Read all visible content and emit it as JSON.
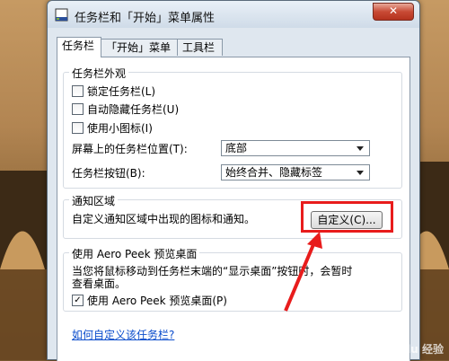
{
  "window": {
    "title": "任务栏和「开始」菜单属性",
    "close_symbol": "✕"
  },
  "tabs": [
    {
      "label": "任务栏",
      "selected": true
    },
    {
      "label": "「开始」菜单",
      "selected": false
    },
    {
      "label": "工具栏",
      "selected": false
    }
  ],
  "appearance": {
    "group_label": "任务栏外观",
    "lock_taskbar": {
      "label": "锁定任务栏(L)",
      "checked": false
    },
    "auto_hide": {
      "label": "自动隐藏任务栏(U)",
      "checked": false
    },
    "small_icons": {
      "label": "使用小图标(I)",
      "checked": false
    },
    "location": {
      "label": "屏幕上的任务栏位置(T):",
      "value": "底部"
    },
    "buttons": {
      "label": "任务栏按钮(B):",
      "value": "始终合并、隐藏标签"
    }
  },
  "notification": {
    "group_label": "通知区域",
    "description": "自定义通知区域中出现的图标和通知。",
    "customize_label": "自定义(C)..."
  },
  "aero_peek": {
    "group_label": "使用 Aero Peek 预览桌面",
    "description_line1": "当您将鼠标移动到任务栏末端的“显示桌面”按钮时，会暂时",
    "description_line2": "查看桌面。",
    "checkbox": {
      "label": "使用 Aero Peek 预览桌面(P)",
      "checked": true,
      "check_mark": "✓"
    }
  },
  "help_link": "如何自定义该任务栏?",
  "watermark": "Baidu 经验",
  "colors": {
    "annotation": "#e81c1c",
    "link": "#0b4dcc"
  }
}
